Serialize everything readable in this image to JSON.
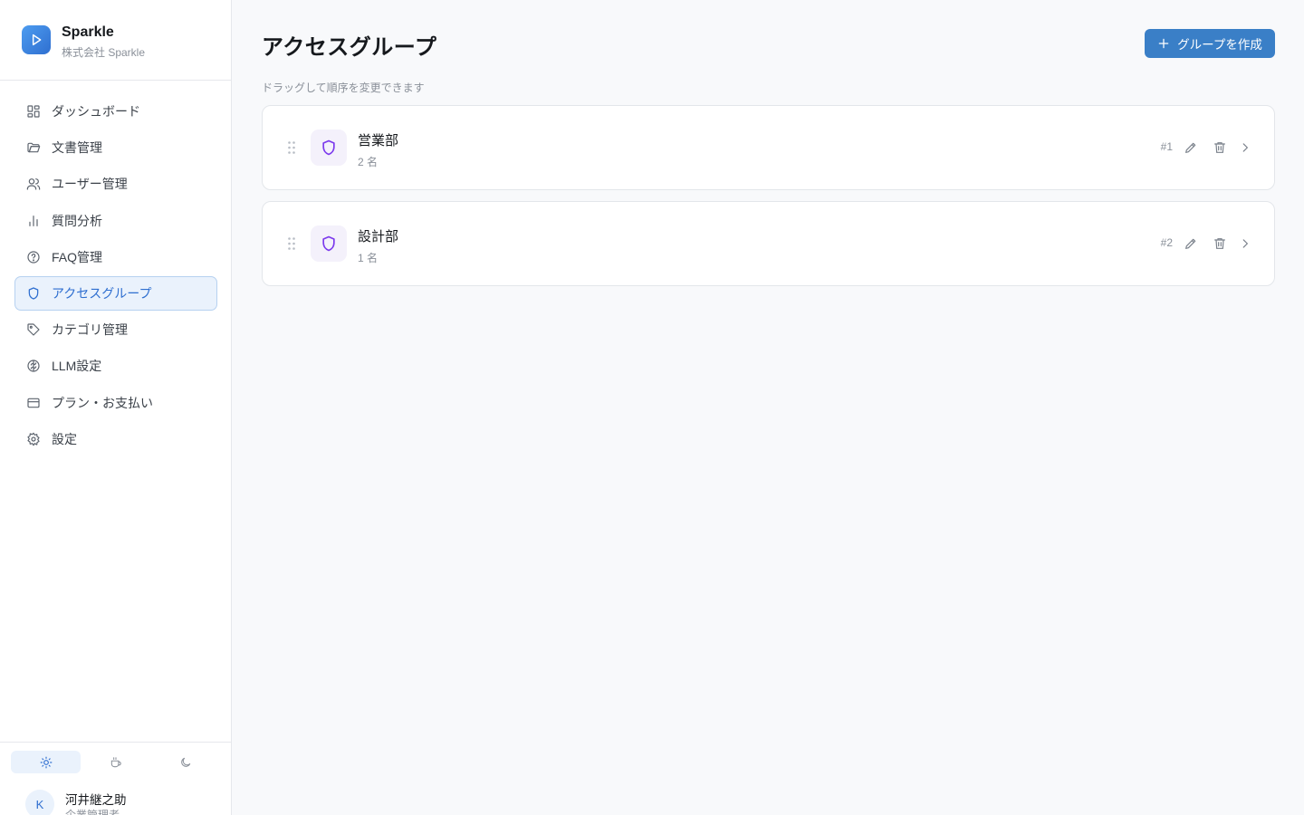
{
  "brand": {
    "name": "Sparkle",
    "company": "株式会社 Sparkle"
  },
  "nav": [
    {
      "label": "ダッシュボード",
      "icon": "dashboard-icon",
      "active": false
    },
    {
      "label": "文書管理",
      "icon": "folder-icon",
      "active": false
    },
    {
      "label": "ユーザー管理",
      "icon": "users-icon",
      "active": false
    },
    {
      "label": "質問分析",
      "icon": "bar-chart-icon",
      "active": false
    },
    {
      "label": "FAQ管理",
      "icon": "help-circle-icon",
      "active": false
    },
    {
      "label": "アクセスグループ",
      "icon": "shield-icon",
      "active": true
    },
    {
      "label": "カテゴリ管理",
      "icon": "tag-icon",
      "active": false
    },
    {
      "label": "LLM設定",
      "icon": "brain-icon",
      "active": false
    },
    {
      "label": "プラン・お支払い",
      "icon": "credit-card-icon",
      "active": false
    },
    {
      "label": "設定",
      "icon": "gear-icon",
      "active": false
    }
  ],
  "theme": {
    "options": [
      "light",
      "coffee",
      "dark"
    ],
    "selected": "light"
  },
  "user": {
    "initial": "K",
    "name": "河井継之助",
    "role": "企業管理者"
  },
  "page": {
    "title": "アクセスグループ",
    "create_label": "グループを作成",
    "hint": "ドラッグして順序を変更できます"
  },
  "groups": [
    {
      "name": "営業部",
      "count": "2 名",
      "order": "#1"
    },
    {
      "name": "設計部",
      "count": "1 名",
      "order": "#2"
    }
  ],
  "colors": {
    "accent": "#2f6fd0",
    "button": "#3a7fc7",
    "group_icon": "#7c3aed"
  }
}
